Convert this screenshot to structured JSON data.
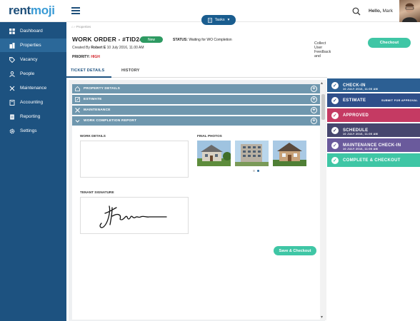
{
  "brand": {
    "logo_rent": "rent",
    "logo_moji": "moji"
  },
  "header": {
    "tasks_label": "Tasks",
    "greeting": "Hello,",
    "user_name": "Mark"
  },
  "sidebar": {
    "items": [
      {
        "label": "Dashboard",
        "icon": "grid-icon"
      },
      {
        "label": "Properties",
        "icon": "building-icon",
        "active": true
      },
      {
        "label": "Vacancy",
        "icon": "tag-icon"
      },
      {
        "label": "People",
        "icon": "person-icon"
      },
      {
        "label": "Maintenance",
        "icon": "wrench-icon"
      },
      {
        "label": "Accounting",
        "icon": "calculator-icon"
      },
      {
        "label": "Reporting",
        "icon": "document-icon"
      },
      {
        "label": "Settings",
        "icon": "gear-icon"
      }
    ]
  },
  "breadcrumb": {
    "item": "Properties"
  },
  "workorder": {
    "title": "WORK ORDER - #TID245",
    "badge": "New",
    "status_label": "STATUS:",
    "status_value": "Waiting for WO Completion",
    "created_prefix": "Created By",
    "created_by": "Robert E",
    "created_date": "10 July 2016, 11.00 AM",
    "priority_label": "PRIORITY:",
    "priority_value": "HIGH"
  },
  "feedback": {
    "text": "Collect User Feedback and",
    "button": "Checkout"
  },
  "tabs": {
    "ticket_details": "TICKET DETAILS",
    "history": "HISTORY"
  },
  "accordion": {
    "items": [
      "PROPERTY DETAILS",
      "ESTIMATE",
      "MAINTENANCE",
      "WORK COMPLETION REPORT"
    ]
  },
  "report": {
    "work_details_label": "WORK DETAILS",
    "final_photos_label": "FINAL PHOTOS",
    "tenant_signature_label": "TENANT SIGNATURE",
    "save_button": "Save & Checkout"
  },
  "workflow": {
    "steps": [
      {
        "label": "CHECK-IN",
        "sub": "10 JULY 2016, 11:00 AM",
        "color": "#2c5f93"
      },
      {
        "label": "ESTIMATE",
        "sub": "SUBMIT FOR APPROVAL",
        "color": "#2f4f8a"
      },
      {
        "label": "APPROVED",
        "sub": "",
        "color": "#c53a63"
      },
      {
        "label": "SCHEDULE",
        "sub": "10 JULY 2016, 11:00 AM",
        "color": "#46466e"
      },
      {
        "label": "MAINTENANCE CHECK-IN",
        "sub": "10 JULY 2016, 11:00 AM",
        "color": "#6a5a9c"
      },
      {
        "label": "COMPLETE & CHECKOUT",
        "sub": "",
        "color": "#3fc6a5"
      }
    ]
  }
}
